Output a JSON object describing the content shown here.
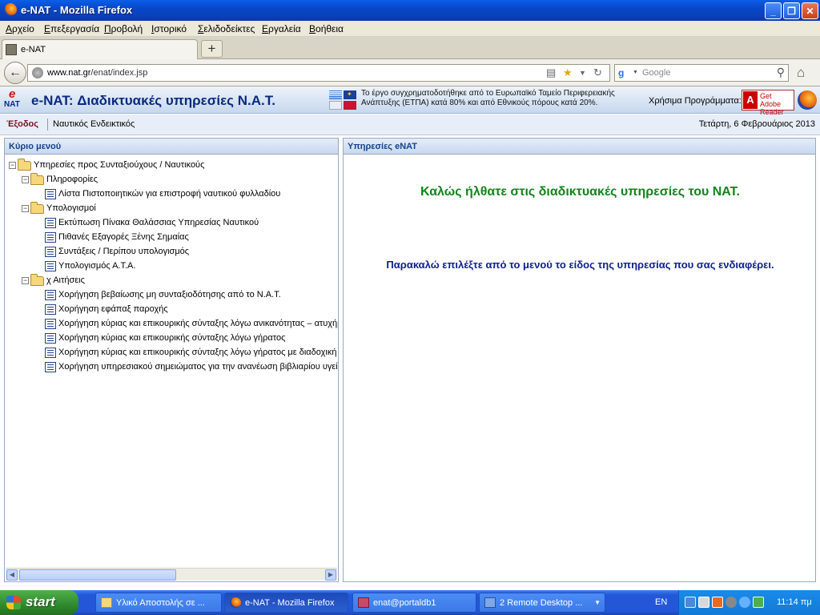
{
  "window": {
    "title": "e-NAT - Mozilla Firefox",
    "minimize": "_",
    "maximize": "❐",
    "close": "✕"
  },
  "menu": [
    "Αρχείο",
    "Επεξεργασία",
    "Προβολή",
    "Ιστορικό",
    "Σελιδοδείκτες",
    "Εργαλεία",
    "Βοήθεια"
  ],
  "tab": {
    "label": "e-NAT",
    "new_tab": "+"
  },
  "nav": {
    "url_host": "www.nat.gr",
    "url_path": "/enat/index.jsp",
    "search_placeholder": "Google"
  },
  "banner": {
    "logo_e": "e",
    "logo_nat": "NAT",
    "title": "e-NAT: Διαδικτυακές υπηρεσίες Ν.Α.Τ.",
    "funding": "Το έργο συγχρηματοδοτήθηκε από το Ευρωπαϊκό Ταμείο Περιφερειακής Ανάπτυξης (ΕΤΠΑ) κατά 80% και από Εθνικούς πόρους κατά 20%.",
    "tools_label": "Χρήσιμα Προγράμματα:",
    "adobe_a": "A",
    "adobe_text_1": "Get",
    "adobe_text_2": "Adobe",
    "adobe_text_3": "Reader"
  },
  "subbar": {
    "logout": "Έξοδος",
    "nautical": "Ναυτικός Ενδεικτικός",
    "date": "Τετάρτη, 6 Φεβρουάριος 2013"
  },
  "left_panel": {
    "header": "Κύριο μενού",
    "tree": [
      {
        "label": "Υπηρεσίες προς Συνταξιούχους / Ναυτικούς",
        "type": "folder",
        "level": 0
      },
      {
        "label": "Πληροφορίες",
        "type": "folder",
        "level": 1
      },
      {
        "label": "Λίστα Πιστοποιητικών για επιστροφή ναυτικού φυλλαδίου",
        "type": "leaf",
        "level": 2
      },
      {
        "label": "Υπολογισμοί",
        "type": "folder",
        "level": 1
      },
      {
        "label": "Εκτύπωση Πίνακα Θαλάσσιας Υπηρεσίας Ναυτικού",
        "type": "leaf",
        "level": 2
      },
      {
        "label": "Πιθανές Εξαγορές Ξένης Σημαίας",
        "type": "leaf",
        "level": 2
      },
      {
        "label": "Συντάξεις / Περίπου υπολογισμός",
        "type": "leaf",
        "level": 2
      },
      {
        "label": "Υπολογισμός Α.Τ.Α.",
        "type": "leaf",
        "level": 2
      },
      {
        "label": "χ Αιτήσεις",
        "type": "folder",
        "level": 1
      },
      {
        "label": "Χορήγηση βεβαίωσης μη συνταξιοδότησης από το Ν.Α.Τ.",
        "type": "leaf",
        "level": 2
      },
      {
        "label": "Χορήγηση εφάπαξ παροχής",
        "type": "leaf",
        "level": 2
      },
      {
        "label": "Χορήγηση κύριας και επικουρικής σύνταξης λόγω ανικανότητας – ατυχήματος",
        "type": "leaf",
        "level": 2
      },
      {
        "label": "Χορήγηση κύριας και επικουρικής σύνταξης λόγω γήρατος",
        "type": "leaf",
        "level": 2
      },
      {
        "label": "Χορήγηση κύριας και επικουρικής σύνταξης λόγω γήρατος με διαδοχική ασφάλιση",
        "type": "leaf",
        "level": 2
      },
      {
        "label": "Χορήγηση υπηρεσιακού σημειώματος για την ανανέωση βιβλιαρίου υγείας",
        "type": "leaf",
        "level": 2
      }
    ]
  },
  "right_panel": {
    "header": "Υπηρεσίες eNAT",
    "welcome": "Καλώς ήλθατε στις διαδικτυακές υπηρεσίες του ΝΑΤ.",
    "instruction": "Παρακαλώ επιλέξτε από το μενού το είδος της υπηρεσίας που σας ενδιαφέρει."
  },
  "taskbar": {
    "start": "start",
    "buttons": [
      {
        "label": "Υλικό Αποστολής σε ...",
        "active": false
      },
      {
        "label": "e-NAT - Mozilla Firefox",
        "active": true
      },
      {
        "label": "enat@portaldb1",
        "active": false
      },
      {
        "label": "2 Remote Desktop ...",
        "active": false
      }
    ],
    "lang": "EN",
    "clock": "11:14 πμ"
  }
}
